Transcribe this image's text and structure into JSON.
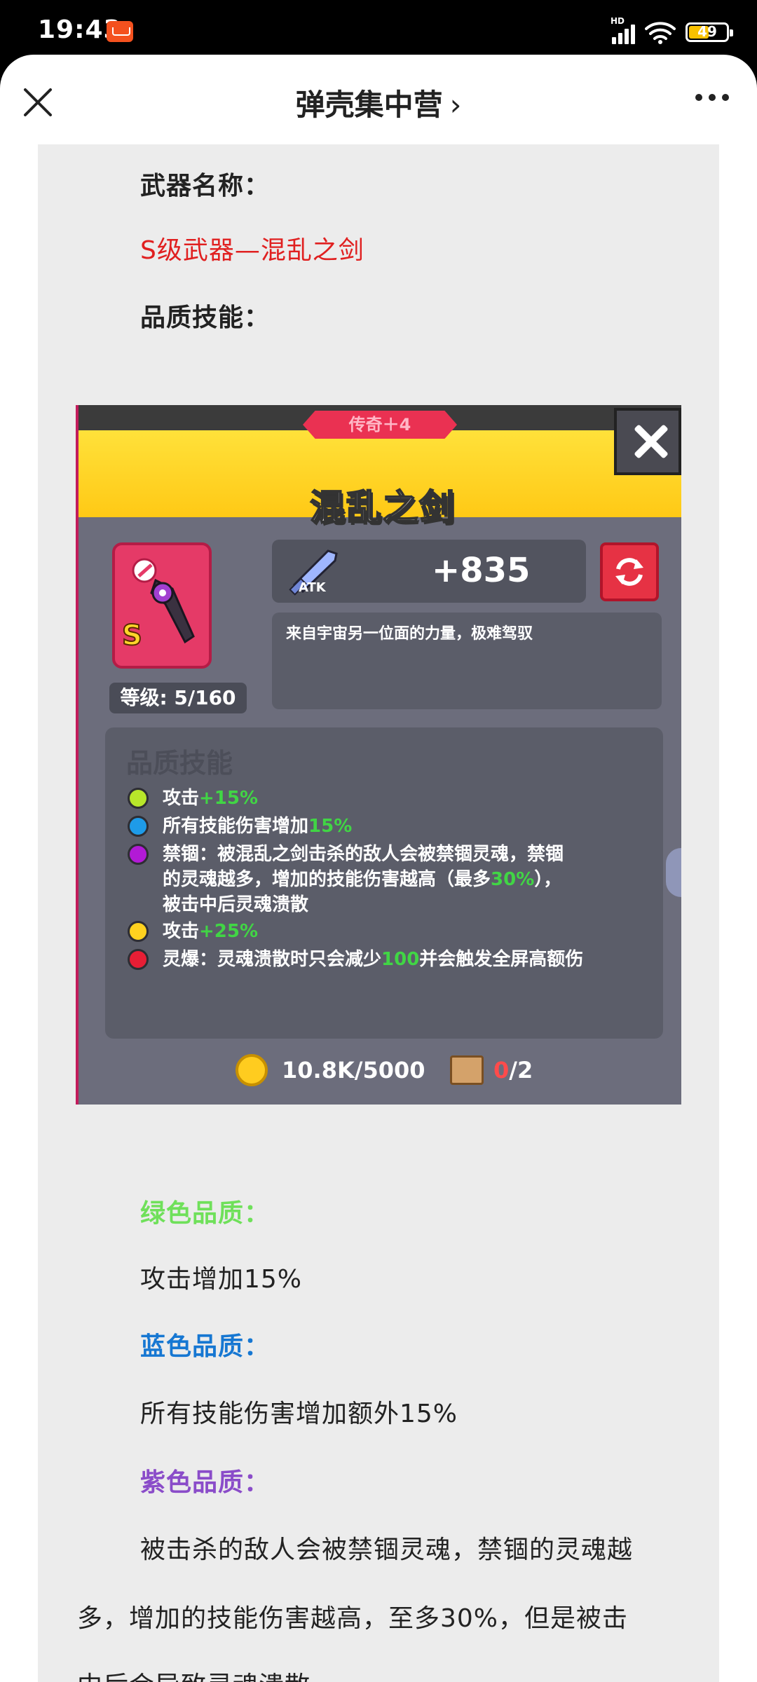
{
  "status_bar": {
    "time": "19:43",
    "hd_label": "HD",
    "battery": "49"
  },
  "header": {
    "title": "弹壳集中营",
    "chevron": "›"
  },
  "article": {
    "weapon_name_label": "武器名称：",
    "weapon_name_value": "S级武器—混乱之剑",
    "quality_skill_label": "品质技能：",
    "green_label": "绿色品质：",
    "green_text": "攻击增加15%",
    "blue_label": "蓝色品质：",
    "blue_text": "所有技能伤害增加额外15%",
    "purple_label": "紫色品质：",
    "purple_line1": "被击杀的敌人会被禁锢灵魂，禁锢的灵魂越",
    "purple_line2": "多，增加的技能伤害越高，至多30%，但是被击",
    "purple_line3": "中后会导致灵魂溃散。"
  },
  "game_card": {
    "rank_tag": "传奇＋4",
    "weapon_title": "混乱之剑",
    "grade_letter": "S",
    "star_level": "4",
    "level": "等级: 5/160",
    "atk_label": "ATK",
    "atk_value": "+835",
    "description": "来自宇宙另一位面的力量，极难驾驭",
    "skills_title": "品质技能",
    "skills": [
      {
        "color": "#b8e62a",
        "text": "攻击",
        "value": "+15%",
        "rest": ""
      },
      {
        "color": "#1e9be8",
        "text": "所有技能伤害增加",
        "value": "15%",
        "rest": ""
      },
      {
        "color": "#b21ad6",
        "text": "禁锢：被混乱之剑击杀的敌人会被禁锢灵魂，禁锢",
        "value": "",
        "rest": ""
      },
      {
        "color": "",
        "text": "的灵魂越多，增加的技能伤害越高（最多",
        "value": "30%",
        "rest": "），"
      },
      {
        "color": "",
        "text": "被击中后灵魂溃散",
        "value": "",
        "rest": ""
      },
      {
        "color": "#ffd21f",
        "text": "攻击",
        "value": "+25%",
        "rest": ""
      },
      {
        "color": "#e81e35",
        "text": "灵爆：灵魂溃散时只会减少",
        "value": "100",
        "rest": "并会触发全屏高额伤"
      }
    ],
    "coins": "10.8K/5000",
    "scroll_have": "0",
    "scroll_need": "/2"
  },
  "icons": [
    "close-icon",
    "more-icon",
    "signal-icon",
    "wifi-icon",
    "battery-icon",
    "sword-icon",
    "refresh-icon",
    "coin-icon",
    "scroll-icon"
  ]
}
